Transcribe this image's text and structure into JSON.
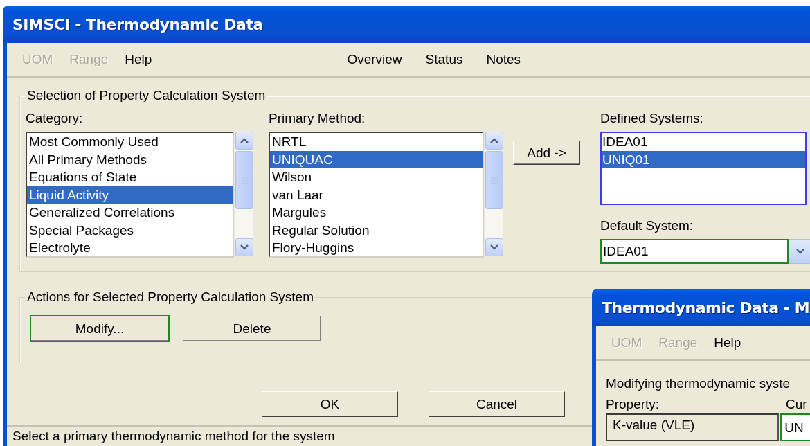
{
  "main_window": {
    "title": "SIMSCI - Thermodynamic Data",
    "menu": [
      {
        "label": "UOM",
        "disabled": true
      },
      {
        "label": "Range",
        "disabled": true
      },
      {
        "label": "Help",
        "disabled": false
      }
    ],
    "view_menu": [
      {
        "label": "Overview"
      },
      {
        "label": "Status"
      },
      {
        "label": "Notes"
      }
    ],
    "selection_group": {
      "title": "Selection of Property Calculation System",
      "category": {
        "label": "Category:",
        "items": [
          {
            "text": "Most Commonly Used",
            "selected": false
          },
          {
            "text": "All Primary Methods",
            "selected": false
          },
          {
            "text": "Equations of State",
            "selected": false
          },
          {
            "text": "Liquid Activity",
            "selected": true
          },
          {
            "text": "Generalized Correlations",
            "selected": false
          },
          {
            "text": "Special Packages",
            "selected": false
          },
          {
            "text": "Electrolyte",
            "selected": false
          }
        ]
      },
      "primary_method": {
        "label": "Primary Method:",
        "items": [
          {
            "text": "NRTL",
            "selected": false
          },
          {
            "text": "UNIQUAC",
            "selected": true
          },
          {
            "text": "Wilson",
            "selected": false
          },
          {
            "text": "van Laar",
            "selected": false
          },
          {
            "text": "Margules",
            "selected": false
          },
          {
            "text": "Regular Solution",
            "selected": false
          },
          {
            "text": "Flory-Huggins",
            "selected": false
          }
        ]
      },
      "add_button": "Add ->",
      "defined_systems": {
        "label": "Defined Systems:",
        "items": [
          {
            "text": "IDEA01",
            "selected": false
          },
          {
            "text": "UNIQ01",
            "selected": true
          }
        ]
      },
      "default_system": {
        "label": "Default System:",
        "value": "IDEA01"
      }
    },
    "actions_group": {
      "title": "Actions for Selected Property Calculation System",
      "buttons": [
        {
          "label": "Modify...",
          "focused": true
        },
        {
          "label": "Delete",
          "focused": false
        }
      ]
    },
    "dialog_buttons": [
      {
        "label": "OK"
      },
      {
        "label": "Cancel"
      }
    ],
    "status_bar": "Select a primary thermodynamic method for the system"
  },
  "second_window": {
    "title": "Thermodynamic Data - M",
    "menu": [
      {
        "label": "UOM",
        "disabled": true
      },
      {
        "label": "Range",
        "disabled": true
      },
      {
        "label": "Help",
        "disabled": false
      }
    ],
    "prompt": "Modifying thermodynamic syste",
    "columns": [
      "Property:",
      "Cur"
    ],
    "property_value": "K-value (VLE)",
    "current_value": "UN"
  }
}
